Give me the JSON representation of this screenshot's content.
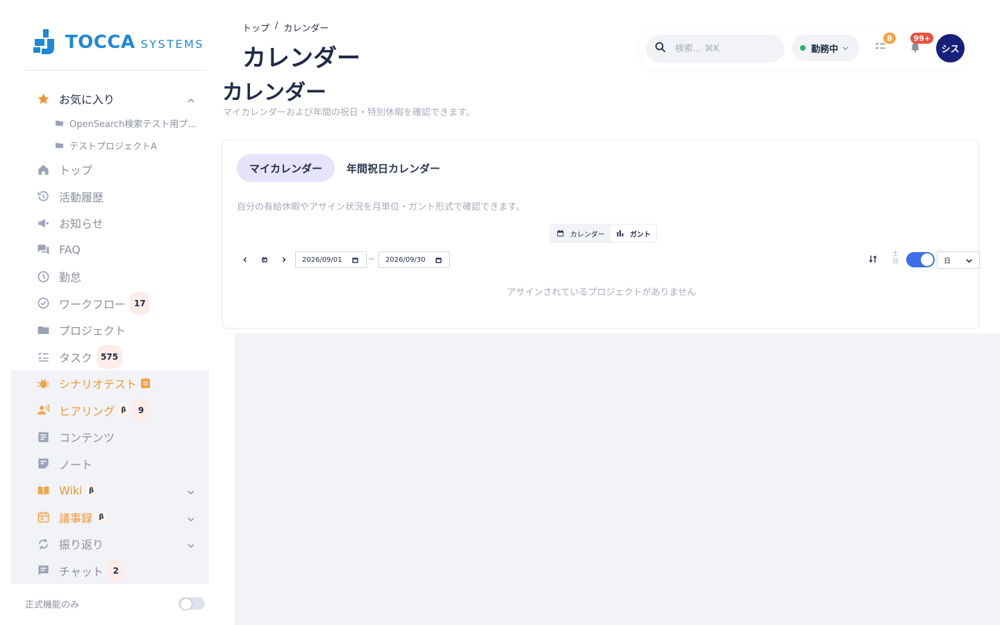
{
  "logo": {
    "main": "TOCCA",
    "sub": "SYSTEMS"
  },
  "sidebar": {
    "favorites_label": "お気に入り",
    "favorite_items": [
      {
        "label": "OpenSearch検索テスト用プ..."
      },
      {
        "label": "テストプロジェクトA"
      }
    ],
    "items": [
      {
        "label": "トップ"
      },
      {
        "label": "活動履歴"
      },
      {
        "label": "お知らせ"
      },
      {
        "label": "FAQ"
      },
      {
        "label": "勤怠"
      },
      {
        "label": "ワークフロー",
        "count": "17"
      },
      {
        "label": "プロジェクト"
      },
      {
        "label": "タスク",
        "count": "575"
      },
      {
        "label": "シナリオテスト",
        "tag": "α"
      },
      {
        "label": "ヒアリング",
        "tag": "β",
        "count": "9"
      },
      {
        "label": "コンテンツ"
      },
      {
        "label": "ノート"
      },
      {
        "label": "Wiki",
        "tag": "β"
      },
      {
        "label": "議事録",
        "tag": "β"
      },
      {
        "label": "振り返り"
      },
      {
        "label": "チャット",
        "count": "2"
      }
    ],
    "footer_label": "正式機能のみ"
  },
  "header": {
    "breadcrumb": [
      "トップ",
      "/",
      "カレンダー"
    ],
    "title": "カレンダー",
    "search_placeholder": "検索... ⌘K",
    "status_label": "勤務中",
    "tasks_badge": "8",
    "notifications_badge": "99+",
    "avatar_label": "シス"
  },
  "page": {
    "title": "カレンダー",
    "description": "マイカレンダーおよび年間の祝日・特別休暇を確認できます。"
  },
  "card": {
    "tabs": [
      "マイカレンダー",
      "年間祝日カレンダー"
    ],
    "description": "自分の有給休暇やアサイン状況を月単位・ガント形式で確認できます。",
    "view_options": [
      "カレンダー",
      "ガント"
    ],
    "date_from": "2026/09/01",
    "date_to": "2026/09/30",
    "date_separator": "~",
    "weekend_label_top": "土",
    "weekend_label_bottom": "日",
    "unit_selected": "日",
    "empty_message": "アサインされているプロジェクトがありません"
  },
  "colors": {
    "accent_blue": "#3b6ee8",
    "brand_blue": "#1e88d6",
    "orange": "#f0962c",
    "avatar_navy": "#16207a",
    "status_green": "#21b36b",
    "badge_orange": "#f4a642",
    "badge_red": "#e8533f",
    "tab_active_bg": "#e6e3fb"
  },
  "icons": {
    "favorites": "star-icon",
    "top": "home-icon",
    "history": "history-icon",
    "news": "megaphone-icon",
    "faq": "chat-bubbles-icon",
    "attendance": "clock-icon",
    "workflow": "check-circle-icon",
    "project": "folder-icon",
    "task": "checklist-icon",
    "scenario": "bug-icon",
    "hearing": "voice-person-icon",
    "content": "document-icon",
    "note": "note-icon",
    "wiki": "book-icon",
    "minutes": "calendar-icon",
    "retro": "refresh-icon",
    "chat": "message-icon"
  }
}
